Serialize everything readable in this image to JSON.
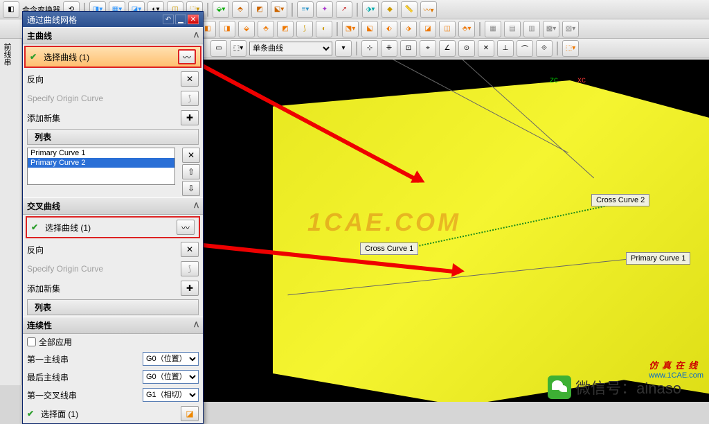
{
  "toolbars": {
    "main_menu_hint": "合令变换器",
    "curve_mode": "单条曲线",
    "left_label": "前线串"
  },
  "dialog": {
    "title": "通过曲线网格",
    "primary": {
      "header": "主曲线",
      "select_curve": "选择曲线 (1)",
      "reverse": "反向",
      "origin": "Specify Origin Curve",
      "add_new": "添加新集",
      "list_hdr": "列表",
      "items": [
        "Primary Curve  1",
        "Primary Curve  2"
      ]
    },
    "cross": {
      "header": "交叉曲线",
      "select_curve": "选择曲线 (1)",
      "reverse": "反向",
      "origin": "Specify Origin Curve",
      "add_new": "添加新集",
      "list_hdr": "列表"
    },
    "continuity": {
      "header": "连续性",
      "apply_all": "全部应用",
      "first_primary": "第一主线串",
      "last_primary": "最后主线串",
      "first_cross": "第一交叉线串",
      "g0": "G0（位置）",
      "g1": "G1（相切）",
      "select_face": "选择面 (1)"
    }
  },
  "viewport": {
    "axes": {
      "z": "ZC",
      "x": "XC"
    },
    "tags": {
      "cross1": "Cross Curve  1",
      "cross2": "Cross Curve  2",
      "primary1": "Primary Curve  1"
    },
    "watermark": "1CAE.COM",
    "wechat_label": "微信号：ainaso",
    "stamp_title": "仿真在线",
    "stamp_url": "www.1CAE.com"
  }
}
